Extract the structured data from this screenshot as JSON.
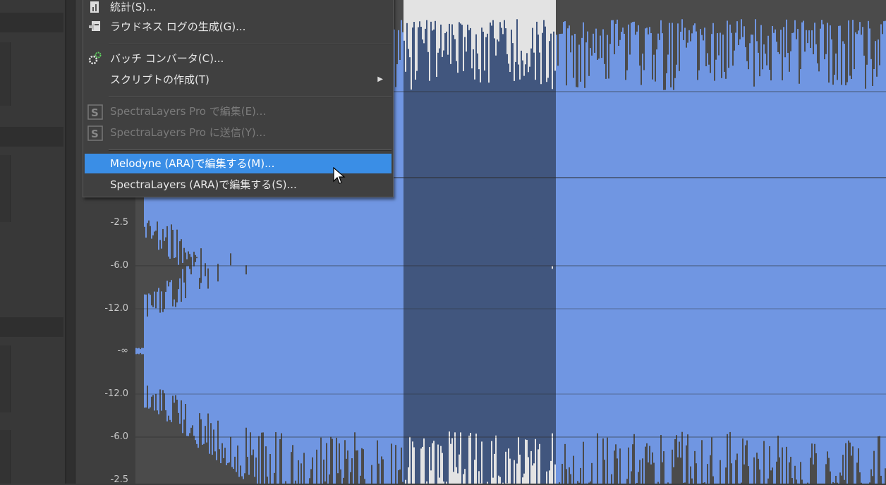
{
  "db_scale": {
    "labels": [
      "-2.5",
      "-6.0",
      "-12.0",
      "-∞",
      "-12.0",
      "-6.0",
      "-2.5"
    ]
  },
  "menu": {
    "items": [
      {
        "label": "統計(S)...",
        "icon": "stats-icon"
      },
      {
        "label": "ラウドネス ログの生成(G)...",
        "icon": "loudness-log-icon"
      },
      {
        "label": "バッチ コンバータ(C)...",
        "icon": "batch-converter-icon"
      },
      {
        "label": "スクリプトの作成(T)",
        "icon": ""
      },
      {
        "label": "SpectraLayers Pro で編集(E)...",
        "icon": "spectralayers-icon"
      },
      {
        "label": "SpectraLayers Pro に送信(Y)...",
        "icon": "spectralayers-icon"
      },
      {
        "label": "Melodyne (ARA)で編集する(M)...",
        "icon": ""
      },
      {
        "label": "SpectraLayers (ARA)で編集する(S)...",
        "icon": ""
      }
    ]
  },
  "colors": {
    "wave_fill": "#7096e2",
    "wave_dark": "#4b4b4b",
    "selection_bg": "#e3e3e3",
    "selection_wave": "#41567e",
    "menu_highlight": "#3a8ee6"
  }
}
